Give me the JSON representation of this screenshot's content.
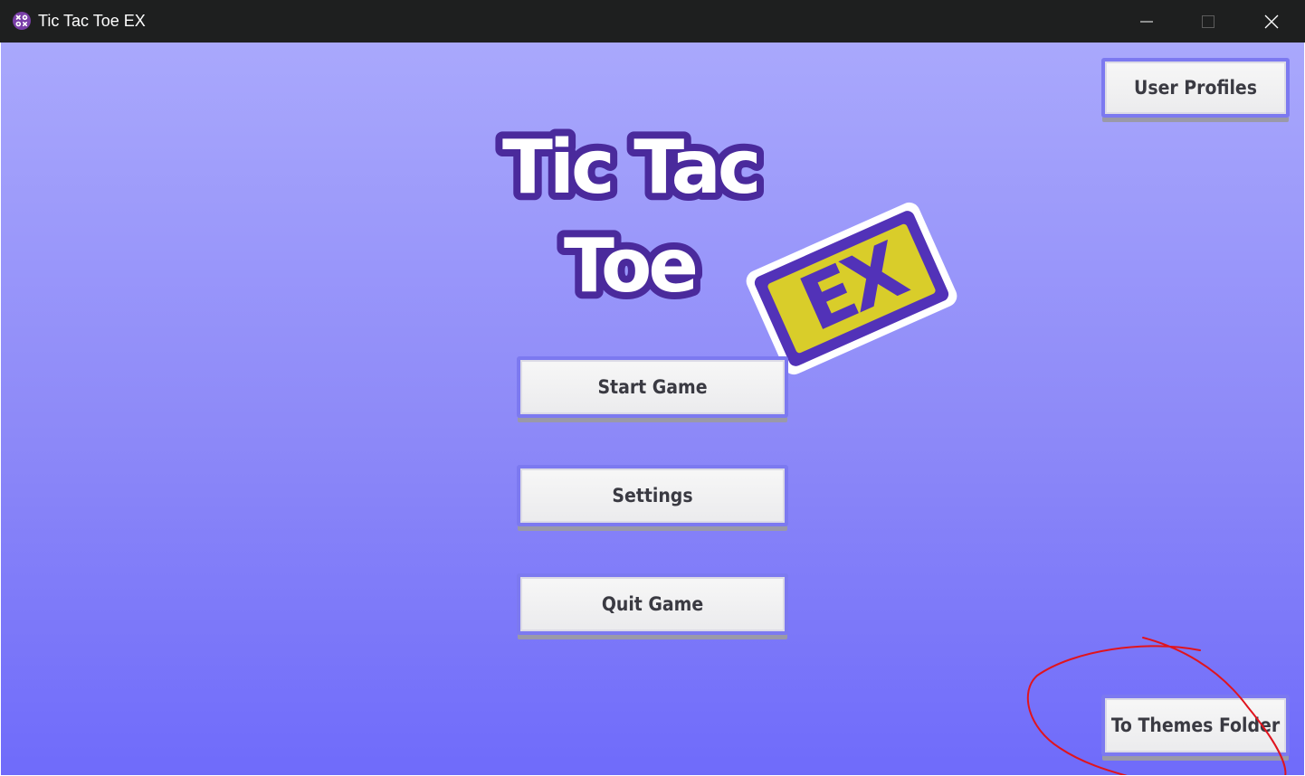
{
  "window": {
    "title": "Tic Tac Toe EX",
    "icon": "tic-tac-toe-app-icon",
    "controls": [
      "minimize-icon",
      "maximize-icon",
      "close-icon"
    ]
  },
  "logo": {
    "line1": "Tic Tac",
    "line2": "Toe",
    "badge": "EX"
  },
  "menu": {
    "start_label": "Start Game",
    "settings_label": "Settings",
    "quit_label": "Quit Game"
  },
  "corner_buttons": {
    "profiles_label": "User Profiles",
    "themes_label": "To Themes Folder"
  },
  "annotation": {
    "type": "hand-drawn circle",
    "target": "To Themes Folder",
    "color": "#e0141e"
  },
  "colors": {
    "titlebar": "#1e1f1f",
    "background_top": "#a9a8fc",
    "background_bottom": "#6f6bfa",
    "logo_outline": "#4a2a9c",
    "logo_badge": "#d9cd2a",
    "button_border": "#7c79f0"
  }
}
